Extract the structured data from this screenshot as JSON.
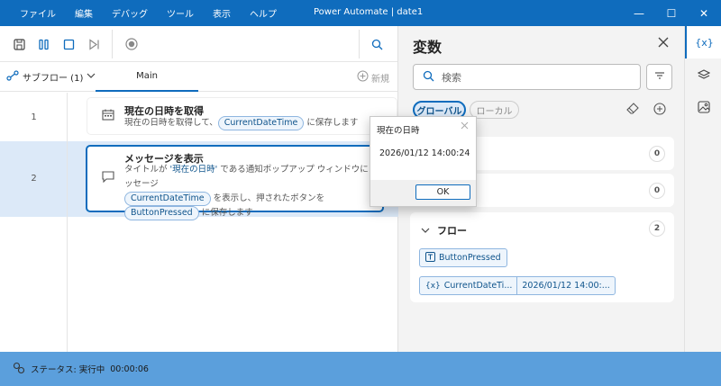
{
  "menu": [
    "ファイル",
    "編集",
    "デバッグ",
    "ツール",
    "表示",
    "ヘルプ"
  ],
  "window": {
    "title": "Power Automate | date1",
    "minimize": "—",
    "maximize": "☐",
    "close": "✕"
  },
  "toolbar": {
    "save_icon": "save-icon",
    "run_icon": "run-icon",
    "stop_icon": "stop-icon",
    "step_icon": "step-icon",
    "record_icon": "record-icon",
    "search_icon": "search-icon"
  },
  "tabs": {
    "subflow_label": "サブフロー (1)",
    "main_label": "Main",
    "new_label": "新規"
  },
  "actions": [
    {
      "number": "1",
      "title": "現在の日時を取得",
      "desc_prefix": "現在の日時を取得して、",
      "var": "CurrentDateTime",
      "desc_suffix": "に保存します"
    },
    {
      "number": "2",
      "title": "メッセージを表示",
      "line1_a": "タイトルが ",
      "line1_quote": "'現在の日時'",
      "line1_b": " である通知ポップアップ ウィンドウにメッセージ",
      "var1": "CurrentDateTime",
      "line2_a": " を表示し、押されたボタンを",
      "var2": "ButtonPressed",
      "line3_a": " に保存します"
    }
  ],
  "variables": {
    "title": "変数",
    "search_placeholder": "検索",
    "global_label": "グローバル",
    "local_label": "ローカル",
    "input_count": "0",
    "output_count": "0",
    "flow_label": "フロー",
    "flow_count": "2",
    "flow_vars": [
      {
        "name": "ButtonPressed",
        "value": ""
      },
      {
        "name": "CurrentDateTi...",
        "value": "2026/01/12 14:00:..."
      }
    ]
  },
  "status": {
    "label": "ステータス: 実行中",
    "time": "00:00:06"
  },
  "dialog": {
    "title": "現在の日時",
    "message": "2026/01/12 14:00:24",
    "ok": "OK"
  }
}
